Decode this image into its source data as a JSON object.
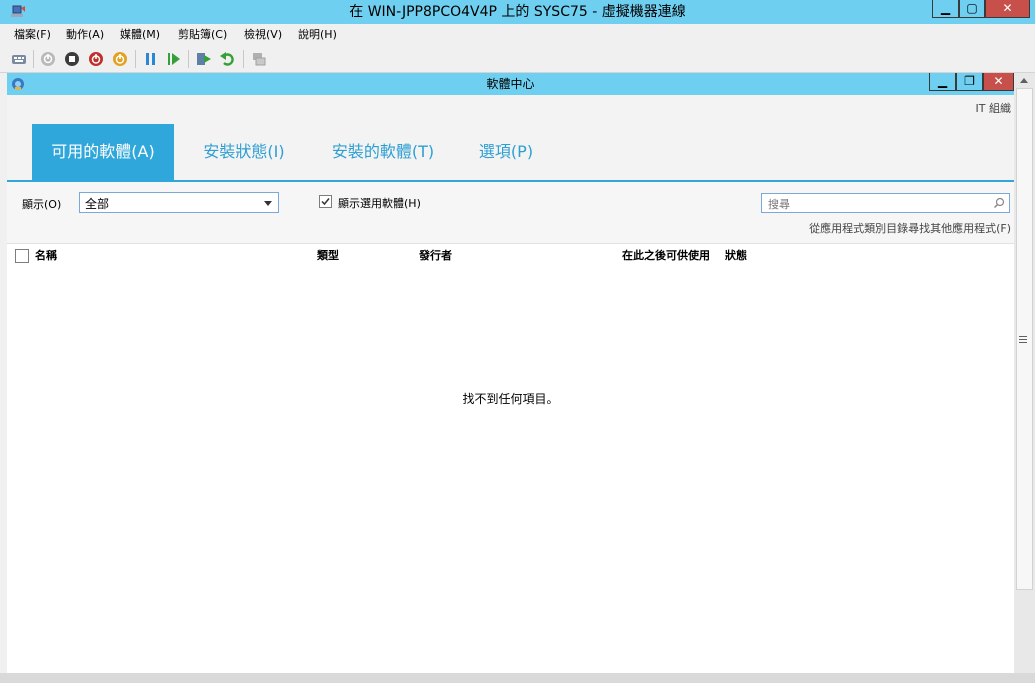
{
  "vm_window": {
    "title": "在 WIN-JPP8PCO4V4P 上的 SYSC75 - 虛擬機器連線",
    "minimize_glyph": "▁",
    "maximize_glyph": "▢",
    "close_glyph": "✕"
  },
  "menu": [
    "檔案(F)",
    "動作(A)",
    "媒體(M)",
    "剪貼簿(C)",
    "檢視(V)",
    "說明(H)"
  ],
  "toolbar": {
    "icons": [
      "ctrl-alt-del-icon",
      "start-icon",
      "turn-off-icon",
      "shut-down-icon",
      "save-icon",
      "pause-icon",
      "resume-icon",
      "checkpoint-icon",
      "revert-icon",
      "enhanced-session-icon"
    ]
  },
  "software_center": {
    "title": "軟體中心",
    "minimize_glyph": "▁",
    "restore_glyph": "❐",
    "close_glyph": "✕",
    "org": "IT 組織",
    "tabs": [
      "可用的軟體(A)",
      "安裝狀態(I)",
      "安裝的軟體(T)",
      "選項(P)"
    ],
    "show_label": "顯示(O)",
    "show_value": "全部",
    "optional_checkbox_label": "顯示選用軟體(H)",
    "optional_checked": true,
    "search_placeholder": "搜尋",
    "catalog_link": "從應用程式類別目錄尋找其他應用程式(F)",
    "columns": [
      "名稱",
      "類型",
      "發行者",
      "在此之後可供使用",
      "狀態"
    ],
    "empty_message": "找不到任何項目。"
  },
  "colors": {
    "titlebar": "#6fcff0",
    "accent": "#2fa7da",
    "close_button": "#c7504b"
  }
}
